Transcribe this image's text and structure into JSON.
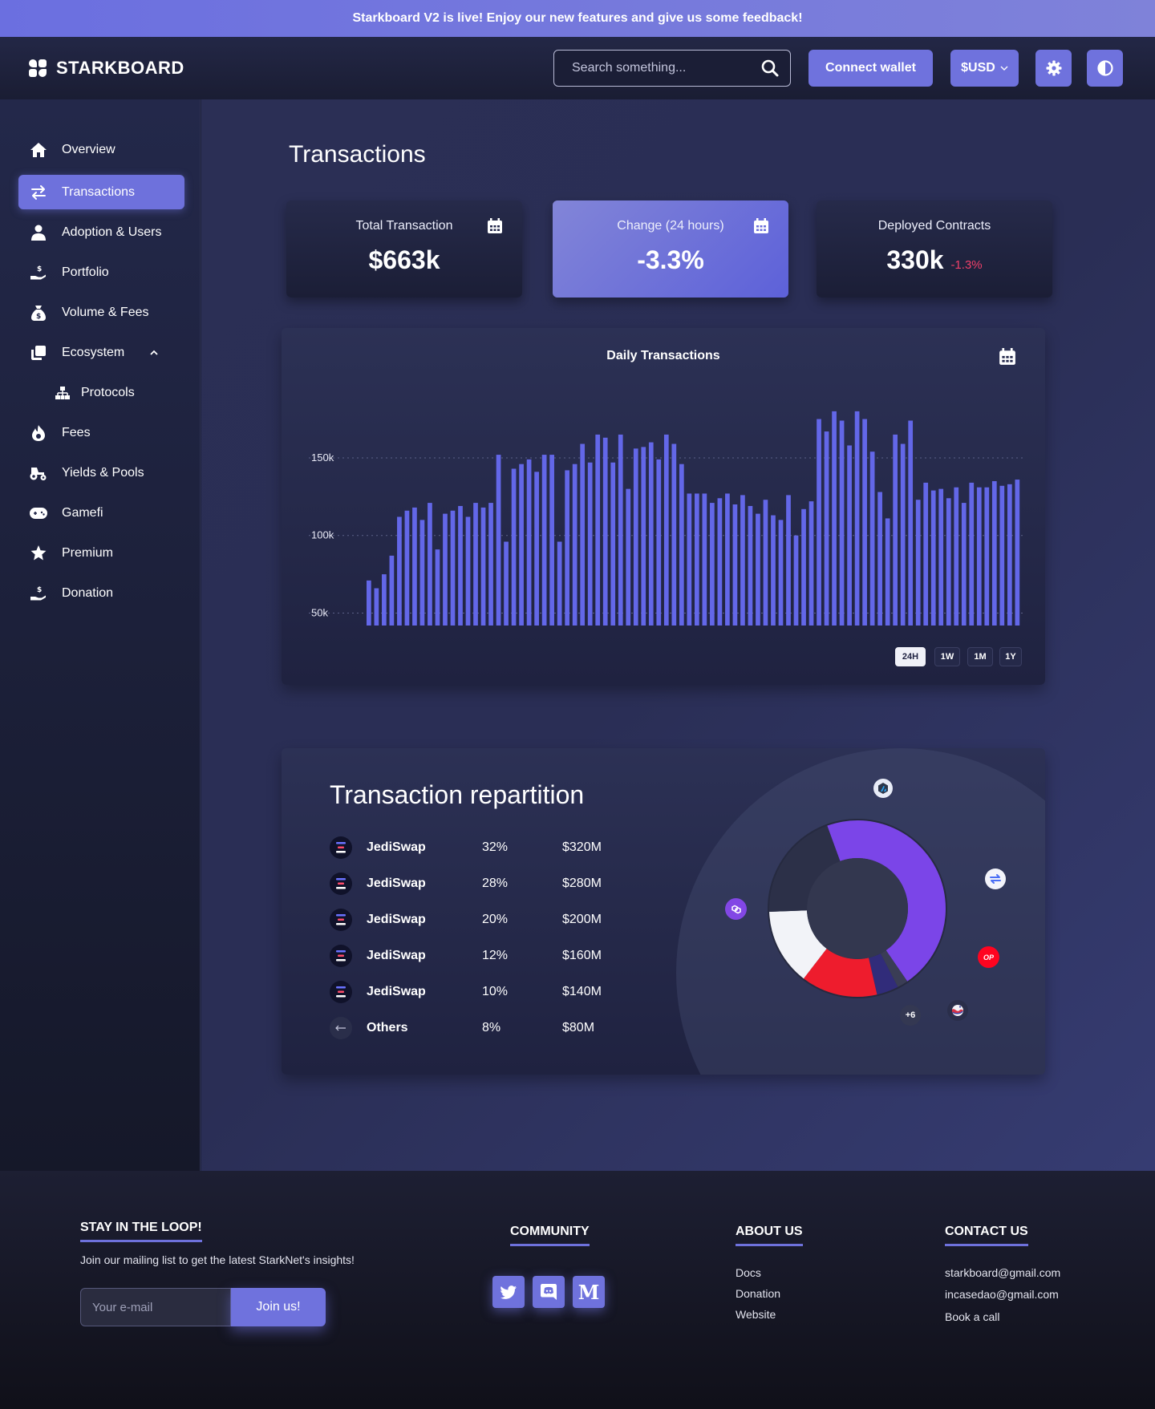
{
  "banner": {
    "text": "Starkboard V2 is live! Enjoy our new features and give us some feedback!"
  },
  "header": {
    "logo_text": "STARKBOARD",
    "search_placeholder": "Search something...",
    "connect_label": "Connect wallet",
    "currency_label": "$USD",
    "settings_icon": "gear-icon",
    "theme_icon": "contrast-icon"
  },
  "sidebar": {
    "items": [
      {
        "label": "Overview",
        "icon": "home-icon",
        "active": false
      },
      {
        "label": "Transactions",
        "icon": "arrows-swap-icon",
        "active": true
      },
      {
        "label": "Adoption & Users",
        "icon": "user-icon",
        "active": false
      },
      {
        "label": "Portfolio",
        "icon": "hand-coin-icon",
        "active": false
      },
      {
        "label": "Volume & Fees",
        "icon": "money-bag-icon",
        "active": false
      },
      {
        "label": "Ecosystem",
        "icon": "copy-icon",
        "active": false,
        "expanded": true
      },
      {
        "label": "Protocols",
        "icon": "sitemap-icon",
        "active": false,
        "sub": true
      },
      {
        "label": "Fees",
        "icon": "fire-icon",
        "active": false
      },
      {
        "label": "Yields & Pools",
        "icon": "tractor-icon",
        "active": false
      },
      {
        "label": "Gamefi",
        "icon": "gamepad-icon",
        "active": false
      },
      {
        "label": "Premium",
        "icon": "star-icon",
        "active": false
      },
      {
        "label": "Donation",
        "icon": "hand-coin-icon",
        "active": false
      }
    ]
  },
  "main": {
    "title": "Transactions",
    "stats": [
      {
        "label": "Total Transaction",
        "value": "$663k",
        "sub": ""
      },
      {
        "label": "Change (24 hours)",
        "value": "-3.3%",
        "sub": ""
      },
      {
        "label": "Deployed Contracts",
        "value": "330k",
        "sub": "-1.3%"
      }
    ],
    "ranges": [
      "24H",
      "1W",
      "1M",
      "1Y"
    ],
    "active_range": "24H"
  },
  "chart_data": {
    "type": "bar",
    "title": "Daily Transactions",
    "xlabel": "",
    "ylabel": "",
    "ylim": [
      42000,
      182000
    ],
    "yticks": [
      {
        "value": 50000,
        "label": "50k"
      },
      {
        "value": 100000,
        "label": "100k"
      },
      {
        "value": 150000,
        "label": "150k"
      }
    ],
    "color": "#6367e8",
    "values": [
      71000,
      66000,
      75000,
      87000,
      112000,
      116000,
      118000,
      110000,
      121000,
      91000,
      114000,
      116000,
      119000,
      112000,
      121000,
      118000,
      121000,
      152000,
      96000,
      143000,
      146000,
      149000,
      141000,
      152000,
      152000,
      96000,
      142000,
      146000,
      159000,
      147000,
      165000,
      163000,
      147000,
      165000,
      130000,
      156000,
      157000,
      160000,
      149000,
      165000,
      159000,
      146000,
      127000,
      127000,
      127000,
      121000,
      124000,
      127000,
      120000,
      126000,
      119000,
      114000,
      123000,
      113000,
      110000,
      126000,
      100000,
      117000,
      122000,
      175000,
      167000,
      180000,
      174000,
      158000,
      180000,
      175000,
      154000,
      128000,
      111000,
      165000,
      159000,
      174000,
      123000,
      134000,
      129000,
      130000,
      124000,
      131000,
      121000,
      134000,
      131000,
      131000,
      135000,
      132000,
      133000,
      136000
    ]
  },
  "repartition": {
    "title": "Transaction repartition",
    "rows": [
      {
        "name": "JediSwap",
        "percent": "32%",
        "amount": "$320M"
      },
      {
        "name": "JediSwap",
        "percent": "28%",
        "amount": "$280M"
      },
      {
        "name": "JediSwap",
        "percent": "20%",
        "amount": "$200M"
      },
      {
        "name": "JediSwap",
        "percent": "12%",
        "amount": "$160M"
      },
      {
        "name": "JediSwap",
        "percent": "10%",
        "amount": "$140M"
      },
      {
        "name": "Others",
        "percent": "8%",
        "amount": "$80M"
      }
    ],
    "donut": [
      {
        "label": "purple",
        "value": 0.46,
        "color": "#7b45e8"
      },
      {
        "label": "gray",
        "value": 0.02,
        "color": "#3a3d55"
      },
      {
        "label": "navy",
        "value": 0.04,
        "color": "#312c7a"
      },
      {
        "label": "red",
        "value": 0.14,
        "color": "#ee1c2d"
      },
      {
        "label": "white",
        "value": 0.14,
        "color": "#f2f3f8"
      },
      {
        "label": "dark",
        "value": 0.2,
        "color": "#2c3048"
      }
    ],
    "more_label": "+6",
    "op_label": "OP"
  },
  "footer": {
    "loop_heading": "STAY IN THE LOOP!",
    "loop_text": "Join our mailing list to get the latest StarkNet's insights!",
    "email_placeholder": "Your e-mail",
    "join_label": "Join us!",
    "community_heading": "COMMUNITY",
    "about_heading": "ABOUT US",
    "about_links": [
      "Docs",
      "Donation",
      "Website"
    ],
    "contact_heading": "CONTACT US",
    "contact_links": [
      "starkboard@gmail.com",
      "incasedao@gmail.com",
      "Book a call"
    ]
  }
}
